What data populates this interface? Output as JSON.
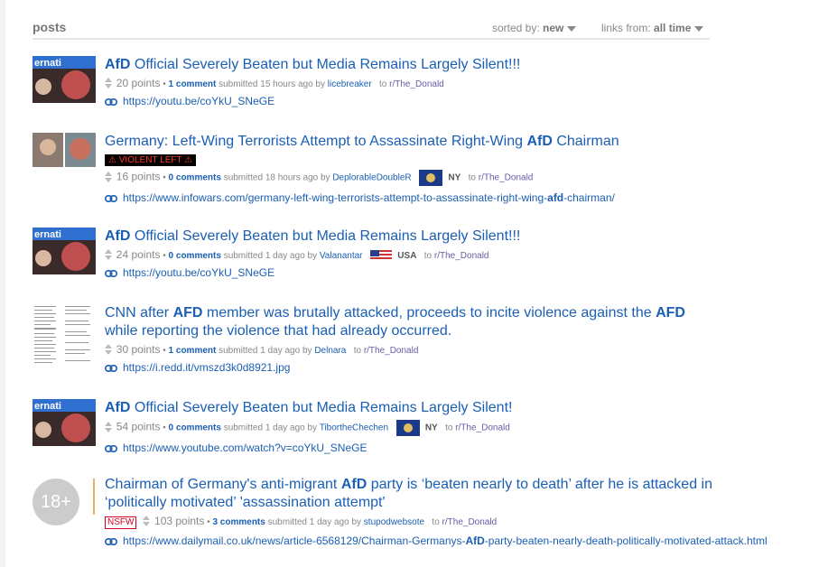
{
  "header": {
    "title": "posts",
    "sorted_label": "sorted by:",
    "sorted_value": "new",
    "links_label": "links from:",
    "links_value": "all time"
  },
  "posts": [
    {
      "title_pre": "",
      "title_bold": "AfD",
      "title_post": " Official Severely Beaten but Media Remains Largely Silent!!!",
      "points": "20 points",
      "comments": "1 comment",
      "submitted": "submitted 15 hours ago by",
      "user": "licebreaker",
      "to": "to",
      "subreddit": "r/The_Donald",
      "url": "https://youtu.be/coYkU_SNeGE"
    },
    {
      "title_pre": "Germany: Left-Wing Terrorists Attempt to Assassinate Right-Wing ",
      "title_bold": "AfD",
      "title_post": " Chairman",
      "flair": "⚠ VIOLENT LEFT ⚠",
      "points": "16 points",
      "comments": "0 comments",
      "submitted": "submitted 18 hours ago by",
      "user": "DeplorableDoubleR",
      "location": "NY",
      "to": "to",
      "subreddit": "r/The_Donald",
      "url_pre": "https://www.infowars.com/germany-left-wing-terrorists-attempt-to-assassinate-right-wing-",
      "url_bold": "afd",
      "url_post": "-chairman/"
    },
    {
      "title_pre": "",
      "title_bold": "AfD",
      "title_post": " Official Severely Beaten but Media Remains Largely Silent!!!",
      "points": "24 points",
      "comments": "0 comments",
      "submitted": "submitted 1 day ago by",
      "user": "Valanantar",
      "location": "USA",
      "to": "to",
      "subreddit": "r/The_Donald",
      "url": "https://youtu.be/coYkU_SNeGE"
    },
    {
      "title_line1_pre": "CNN after ",
      "title_line1_bold": "AFD",
      "title_line1_mid": " member was brutally attacked, proceeds to incite violence against the ",
      "title_line1_bold2": "AFD",
      "title_line2": "while reporting the violence that had already occurred.",
      "points": "30 points",
      "comments": "1 comment",
      "submitted": "submitted 1 day ago by",
      "user": "Delnara",
      "to": "to",
      "subreddit": "r/The_Donald",
      "url": "https://i.redd.it/vmszd3k0d8921.jpg"
    },
    {
      "title_pre": "",
      "title_bold": "AfD",
      "title_post": " Official Severely Beaten but Media Remains Largely Silent!",
      "points": "54 points",
      "comments": "0 comments",
      "submitted": "submitted 1 day ago by",
      "user": "TibortheChechen",
      "location": "NY",
      "to": "to",
      "subreddit": "r/The_Donald",
      "url": "https://www.youtube.com/watch?v=coYkU_SNeGE"
    },
    {
      "title_line1_pre": "Chairman of Germany's anti-migrant ",
      "title_line1_bold": "AfD",
      "title_line1_post": " party is ‘beaten nearly to death’ after he is attacked in",
      "title_line2": "‘politically motivated’ 'assassination attempt'",
      "nsfw_label": "NSFW",
      "thumb_label": "18+",
      "points": "103 points",
      "comments": "3 comments",
      "submitted": "submitted 1 day ago by",
      "user": "stupodwebsote",
      "to": "to",
      "subreddit": "r/The_Donald",
      "url_pre": "https://www.dailymail.co.uk/news/article-6568129/Chairman-Germanys-",
      "url_bold": "AfD",
      "url_post": "-party-beaten-nearly-death-politically-motivated-attack.html"
    }
  ]
}
